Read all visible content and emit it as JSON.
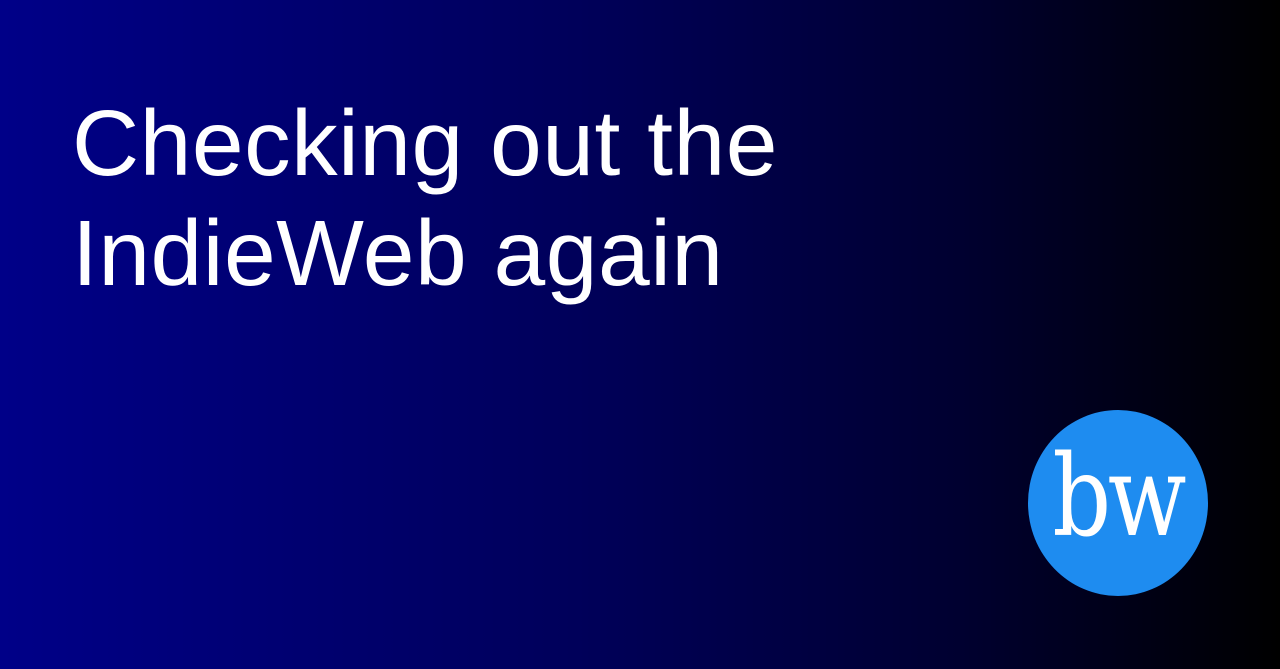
{
  "title": "Checking out the IndieWeb again",
  "logo": {
    "text": "bw",
    "color": "#1e8cf0"
  }
}
